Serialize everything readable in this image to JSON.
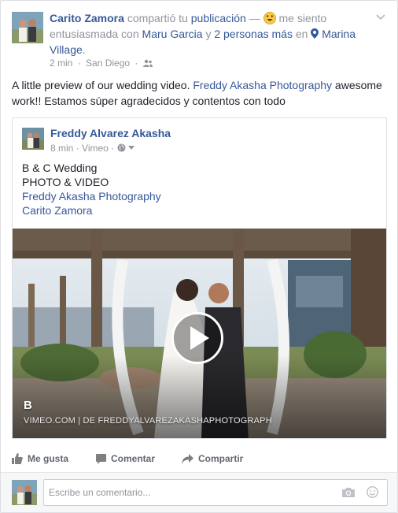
{
  "post": {
    "author": "Carito Zamora",
    "shared_text": "compartió tu",
    "publication_link": "publicación",
    "dash": "—",
    "feeling_text": "me siento",
    "feeling_value": "entusiasmada con",
    "tagged_1": "Maru Garcia",
    "and_text": "y",
    "tagged_others": "2 personas más",
    "in_text": "en",
    "location": "Marina Village",
    "period": ".",
    "time": "2 min",
    "place": "San Diego",
    "text_before_link": "A little preview of our wedding video.",
    "text_link": "Freddy Akasha Photography",
    "text_after_link": "awesome work!! Estamos súper agradecidos y contentos con todo"
  },
  "shared": {
    "author": "Freddy Alvarez Akasha",
    "time": "8 min",
    "source": "Vimeo",
    "lines": [
      "B & C Wedding",
      "PHOTO & VIDEO"
    ],
    "links": [
      "Freddy Akasha Photography",
      "Carito Zamora"
    ],
    "video_title": "B",
    "video_source": "VIMEO.COM | DE FREDDYALVAREZAKASHAPHOTOGRAPH"
  },
  "actions": {
    "like": "Me gusta",
    "comment": "Comentar",
    "share": "Compartir"
  },
  "comment_box": {
    "placeholder": "Escribe un comentario..."
  },
  "colors": {
    "link": "#365899",
    "meta": "#90949c",
    "action": "#616770"
  },
  "icons": [
    "chevron-down-icon",
    "friends-icon",
    "globe-icon",
    "location-pin-icon",
    "excited-emoji-icon",
    "play-icon",
    "like-icon",
    "comment-icon",
    "share-icon",
    "camera-icon",
    "smiley-icon"
  ]
}
